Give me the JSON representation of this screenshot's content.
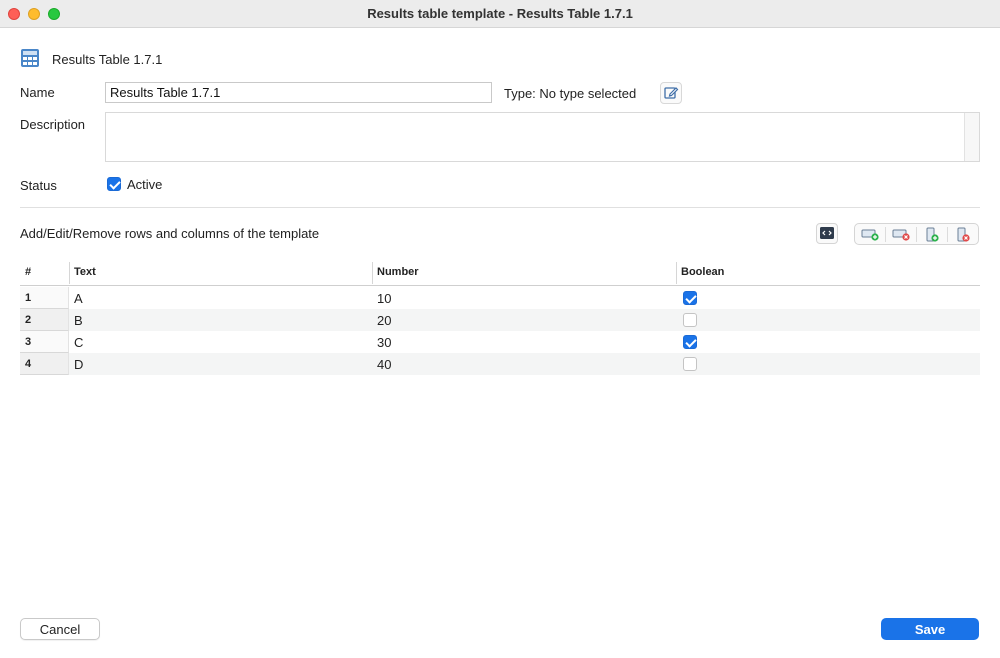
{
  "window": {
    "title": "Results table template - Results Table 1.7.1"
  },
  "header": {
    "icon": "calculator-table-icon",
    "title": "Results Table 1.7.1"
  },
  "form": {
    "name_label": "Name",
    "name_value": "Results Table 1.7.1",
    "type_text": "Type: No type selected",
    "description_label": "Description",
    "description_value": "",
    "status_label": "Status",
    "active_label": "Active",
    "active_checked": true
  },
  "section": {
    "label": "Add/Edit/Remove rows and columns of the template"
  },
  "toolbar": {
    "icons": [
      "code-view-icon",
      "add-row-icon",
      "remove-row-icon",
      "add-column-icon",
      "remove-column-icon"
    ]
  },
  "table": {
    "columns": [
      "#",
      "Text",
      "Number",
      "Boolean"
    ],
    "rows": [
      {
        "num": "1",
        "text": "A",
        "number": "10",
        "boolean": true
      },
      {
        "num": "2",
        "text": "B",
        "number": "20",
        "boolean": false
      },
      {
        "num": "3",
        "text": "C",
        "number": "30",
        "boolean": true
      },
      {
        "num": "4",
        "text": "D",
        "number": "40",
        "boolean": false
      }
    ]
  },
  "footer": {
    "cancel_label": "Cancel",
    "save_label": "Save"
  },
  "colors": {
    "accent": "#1a73e8",
    "add": "#2bb24c",
    "remove": "#e04848"
  }
}
